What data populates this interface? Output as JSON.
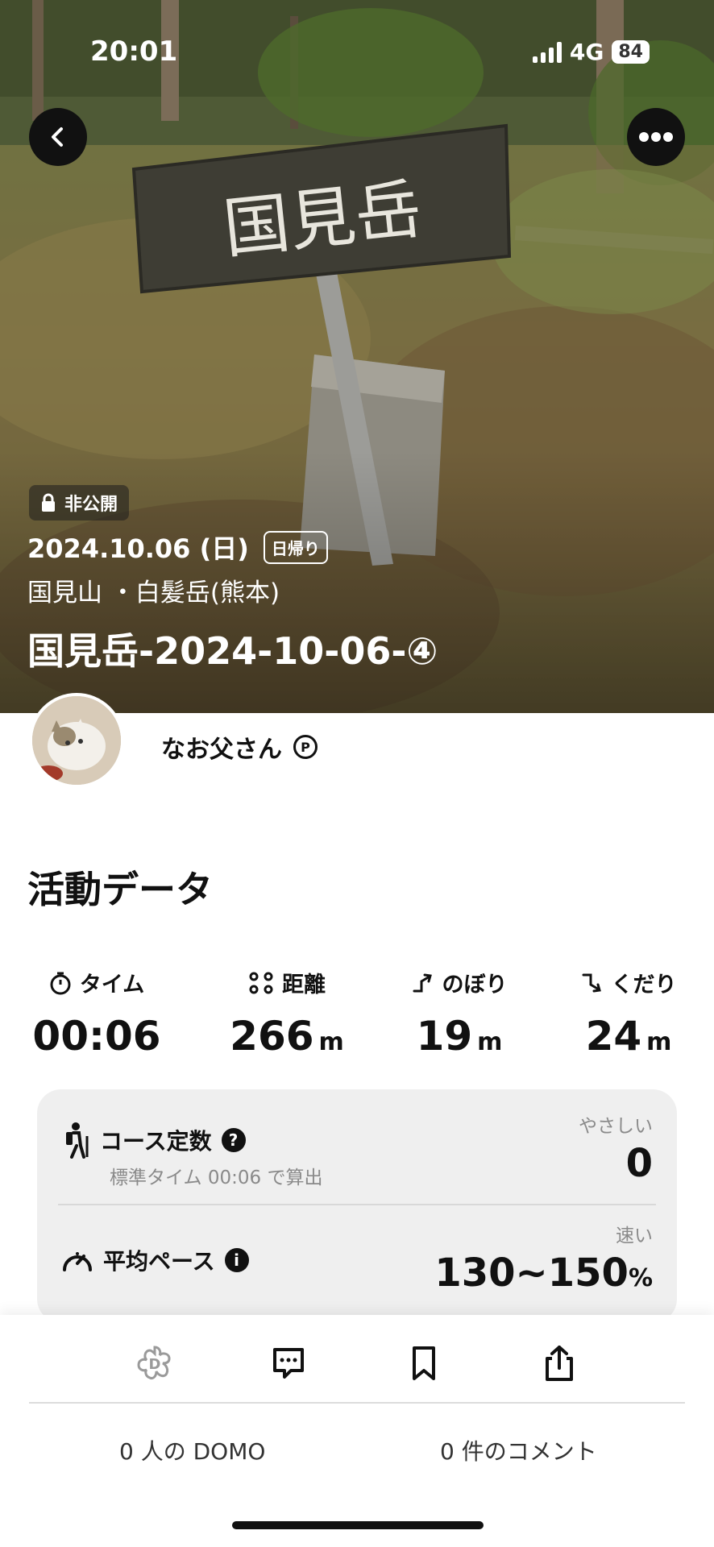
{
  "status_bar": {
    "time": "20:01",
    "network": "4G",
    "battery": "84"
  },
  "header": {
    "private_label": "非公開",
    "date": "2024.10.06 (日)",
    "trip_type": "日帰り",
    "area": "国見山 ・白髪岳(熊本)",
    "title": "国見岳-2024-10-06-④",
    "sign_text": "国見岳"
  },
  "user": {
    "name": "なお父さん",
    "badge": "P"
  },
  "activity": {
    "section_title": "活動データ",
    "stats": [
      {
        "label": "タイム",
        "value": "00:06",
        "unit": "",
        "icon": "stopwatch-icon"
      },
      {
        "label": "距離",
        "value": "266",
        "unit": "m",
        "icon": "route-icon"
      },
      {
        "label": "のぼり",
        "value": "19",
        "unit": "m",
        "icon": "ascent-icon"
      },
      {
        "label": "くだり",
        "value": "24",
        "unit": "m",
        "icon": "descent-icon"
      }
    ],
    "course": {
      "label": "コース定数",
      "sub": "標準タイム 00:06 で算出",
      "tag": "やさしい",
      "value": "0",
      "help": "?"
    },
    "pace": {
      "label": "平均ペース",
      "tag": "速い",
      "value": "130~150",
      "unit": "%",
      "info": "i"
    }
  },
  "footer": {
    "domo_count": "0 人の DOMO",
    "comment_count": "0 件のコメント"
  }
}
